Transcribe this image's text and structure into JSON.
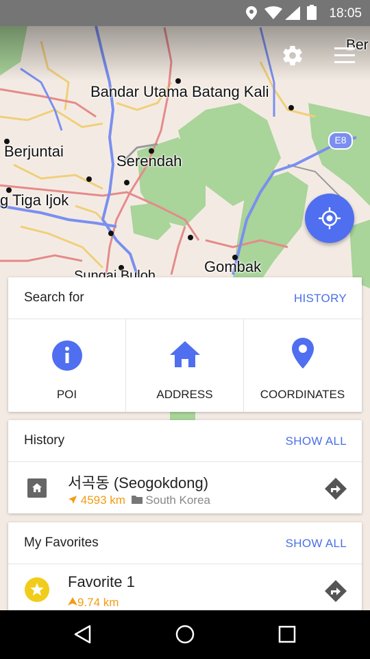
{
  "status_bar": {
    "time": "18:05",
    "icons": [
      "location-icon",
      "wifi-icon",
      "signal-icon",
      "battery-icon"
    ]
  },
  "map": {
    "labels": [
      "Bandar Utama Batang Kali",
      "Berjuntai",
      "Serendah",
      "g Tiga Ijok",
      "Gombak",
      "Sungai Buloh",
      "Ber",
      "E8"
    ],
    "colors": {
      "land": "#f3ebe3",
      "forest": "#a9d49a",
      "major_road": "#7a8ff0",
      "road": "#e58a8a",
      "minor_road": "#f0cf7a"
    }
  },
  "toolbar": {
    "settings_icon": "gear-icon",
    "menu_icon": "hamburger-menu-icon"
  },
  "locate_button": {
    "icon": "crosshair-icon",
    "color": "#4f6ff0"
  },
  "search_card": {
    "title": "Search for",
    "action": "HISTORY",
    "options": [
      {
        "label": "POI",
        "icon": "info-icon"
      },
      {
        "label": "ADDRESS",
        "icon": "home-icon"
      },
      {
        "label": "COORDINATES",
        "icon": "location-pin-icon"
      }
    ]
  },
  "history_card": {
    "title": "History",
    "action": "SHOW ALL",
    "items": [
      {
        "name": "서곡동 (Seogokdong)",
        "distance": "4593 km",
        "location": "South Korea"
      }
    ]
  },
  "favorites_card": {
    "title": "My Favorites",
    "action": "SHOW ALL",
    "items": [
      {
        "name": "Favorite 1",
        "distance": "9.74 km"
      }
    ]
  },
  "accent_color": "#4a6ee8",
  "distance_color": "#f39c12"
}
